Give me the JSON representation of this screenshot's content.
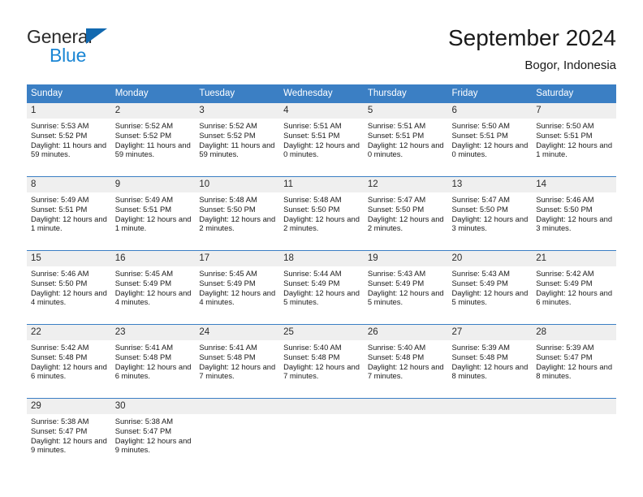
{
  "brand": {
    "line1": "General",
    "line2": "Blue",
    "triangle_color": "#1269b0",
    "blue_text_color": "#1b86d4"
  },
  "header": {
    "title": "September 2024",
    "subtitle": "Bogor, Indonesia"
  },
  "colors": {
    "header_blue": "#3b7fc4",
    "day_band_gray": "#efefef",
    "text": "#1a1a1a"
  },
  "weekdays": [
    "Sunday",
    "Monday",
    "Tuesday",
    "Wednesday",
    "Thursday",
    "Friday",
    "Saturday"
  ],
  "weeks": [
    [
      {
        "day": "1",
        "sunrise": "Sunrise: 5:53 AM",
        "sunset": "Sunset: 5:52 PM",
        "daylight": "Daylight: 11 hours and 59 minutes."
      },
      {
        "day": "2",
        "sunrise": "Sunrise: 5:52 AM",
        "sunset": "Sunset: 5:52 PM",
        "daylight": "Daylight: 11 hours and 59 minutes."
      },
      {
        "day": "3",
        "sunrise": "Sunrise: 5:52 AM",
        "sunset": "Sunset: 5:52 PM",
        "daylight": "Daylight: 11 hours and 59 minutes."
      },
      {
        "day": "4",
        "sunrise": "Sunrise: 5:51 AM",
        "sunset": "Sunset: 5:51 PM",
        "daylight": "Daylight: 12 hours and 0 minutes."
      },
      {
        "day": "5",
        "sunrise": "Sunrise: 5:51 AM",
        "sunset": "Sunset: 5:51 PM",
        "daylight": "Daylight: 12 hours and 0 minutes."
      },
      {
        "day": "6",
        "sunrise": "Sunrise: 5:50 AM",
        "sunset": "Sunset: 5:51 PM",
        "daylight": "Daylight: 12 hours and 0 minutes."
      },
      {
        "day": "7",
        "sunrise": "Sunrise: 5:50 AM",
        "sunset": "Sunset: 5:51 PM",
        "daylight": "Daylight: 12 hours and 1 minute."
      }
    ],
    [
      {
        "day": "8",
        "sunrise": "Sunrise: 5:49 AM",
        "sunset": "Sunset: 5:51 PM",
        "daylight": "Daylight: 12 hours and 1 minute."
      },
      {
        "day": "9",
        "sunrise": "Sunrise: 5:49 AM",
        "sunset": "Sunset: 5:51 PM",
        "daylight": "Daylight: 12 hours and 1 minute."
      },
      {
        "day": "10",
        "sunrise": "Sunrise: 5:48 AM",
        "sunset": "Sunset: 5:50 PM",
        "daylight": "Daylight: 12 hours and 2 minutes."
      },
      {
        "day": "11",
        "sunrise": "Sunrise: 5:48 AM",
        "sunset": "Sunset: 5:50 PM",
        "daylight": "Daylight: 12 hours and 2 minutes."
      },
      {
        "day": "12",
        "sunrise": "Sunrise: 5:47 AM",
        "sunset": "Sunset: 5:50 PM",
        "daylight": "Daylight: 12 hours and 2 minutes."
      },
      {
        "day": "13",
        "sunrise": "Sunrise: 5:47 AM",
        "sunset": "Sunset: 5:50 PM",
        "daylight": "Daylight: 12 hours and 3 minutes."
      },
      {
        "day": "14",
        "sunrise": "Sunrise: 5:46 AM",
        "sunset": "Sunset: 5:50 PM",
        "daylight": "Daylight: 12 hours and 3 minutes."
      }
    ],
    [
      {
        "day": "15",
        "sunrise": "Sunrise: 5:46 AM",
        "sunset": "Sunset: 5:50 PM",
        "daylight": "Daylight: 12 hours and 4 minutes."
      },
      {
        "day": "16",
        "sunrise": "Sunrise: 5:45 AM",
        "sunset": "Sunset: 5:49 PM",
        "daylight": "Daylight: 12 hours and 4 minutes."
      },
      {
        "day": "17",
        "sunrise": "Sunrise: 5:45 AM",
        "sunset": "Sunset: 5:49 PM",
        "daylight": "Daylight: 12 hours and 4 minutes."
      },
      {
        "day": "18",
        "sunrise": "Sunrise: 5:44 AM",
        "sunset": "Sunset: 5:49 PM",
        "daylight": "Daylight: 12 hours and 5 minutes."
      },
      {
        "day": "19",
        "sunrise": "Sunrise: 5:43 AM",
        "sunset": "Sunset: 5:49 PM",
        "daylight": "Daylight: 12 hours and 5 minutes."
      },
      {
        "day": "20",
        "sunrise": "Sunrise: 5:43 AM",
        "sunset": "Sunset: 5:49 PM",
        "daylight": "Daylight: 12 hours and 5 minutes."
      },
      {
        "day": "21",
        "sunrise": "Sunrise: 5:42 AM",
        "sunset": "Sunset: 5:49 PM",
        "daylight": "Daylight: 12 hours and 6 minutes."
      }
    ],
    [
      {
        "day": "22",
        "sunrise": "Sunrise: 5:42 AM",
        "sunset": "Sunset: 5:48 PM",
        "daylight": "Daylight: 12 hours and 6 minutes."
      },
      {
        "day": "23",
        "sunrise": "Sunrise: 5:41 AM",
        "sunset": "Sunset: 5:48 PM",
        "daylight": "Daylight: 12 hours and 6 minutes."
      },
      {
        "day": "24",
        "sunrise": "Sunrise: 5:41 AM",
        "sunset": "Sunset: 5:48 PM",
        "daylight": "Daylight: 12 hours and 7 minutes."
      },
      {
        "day": "25",
        "sunrise": "Sunrise: 5:40 AM",
        "sunset": "Sunset: 5:48 PM",
        "daylight": "Daylight: 12 hours and 7 minutes."
      },
      {
        "day": "26",
        "sunrise": "Sunrise: 5:40 AM",
        "sunset": "Sunset: 5:48 PM",
        "daylight": "Daylight: 12 hours and 7 minutes."
      },
      {
        "day": "27",
        "sunrise": "Sunrise: 5:39 AM",
        "sunset": "Sunset: 5:48 PM",
        "daylight": "Daylight: 12 hours and 8 minutes."
      },
      {
        "day": "28",
        "sunrise": "Sunrise: 5:39 AM",
        "sunset": "Sunset: 5:47 PM",
        "daylight": "Daylight: 12 hours and 8 minutes."
      }
    ],
    [
      {
        "day": "29",
        "sunrise": "Sunrise: 5:38 AM",
        "sunset": "Sunset: 5:47 PM",
        "daylight": "Daylight: 12 hours and 9 minutes."
      },
      {
        "day": "30",
        "sunrise": "Sunrise: 5:38 AM",
        "sunset": "Sunset: 5:47 PM",
        "daylight": "Daylight: 12 hours and 9 minutes."
      },
      {
        "day": "",
        "sunrise": "",
        "sunset": "",
        "daylight": ""
      },
      {
        "day": "",
        "sunrise": "",
        "sunset": "",
        "daylight": ""
      },
      {
        "day": "",
        "sunrise": "",
        "sunset": "",
        "daylight": ""
      },
      {
        "day": "",
        "sunrise": "",
        "sunset": "",
        "daylight": ""
      },
      {
        "day": "",
        "sunrise": "",
        "sunset": "",
        "daylight": ""
      }
    ]
  ]
}
